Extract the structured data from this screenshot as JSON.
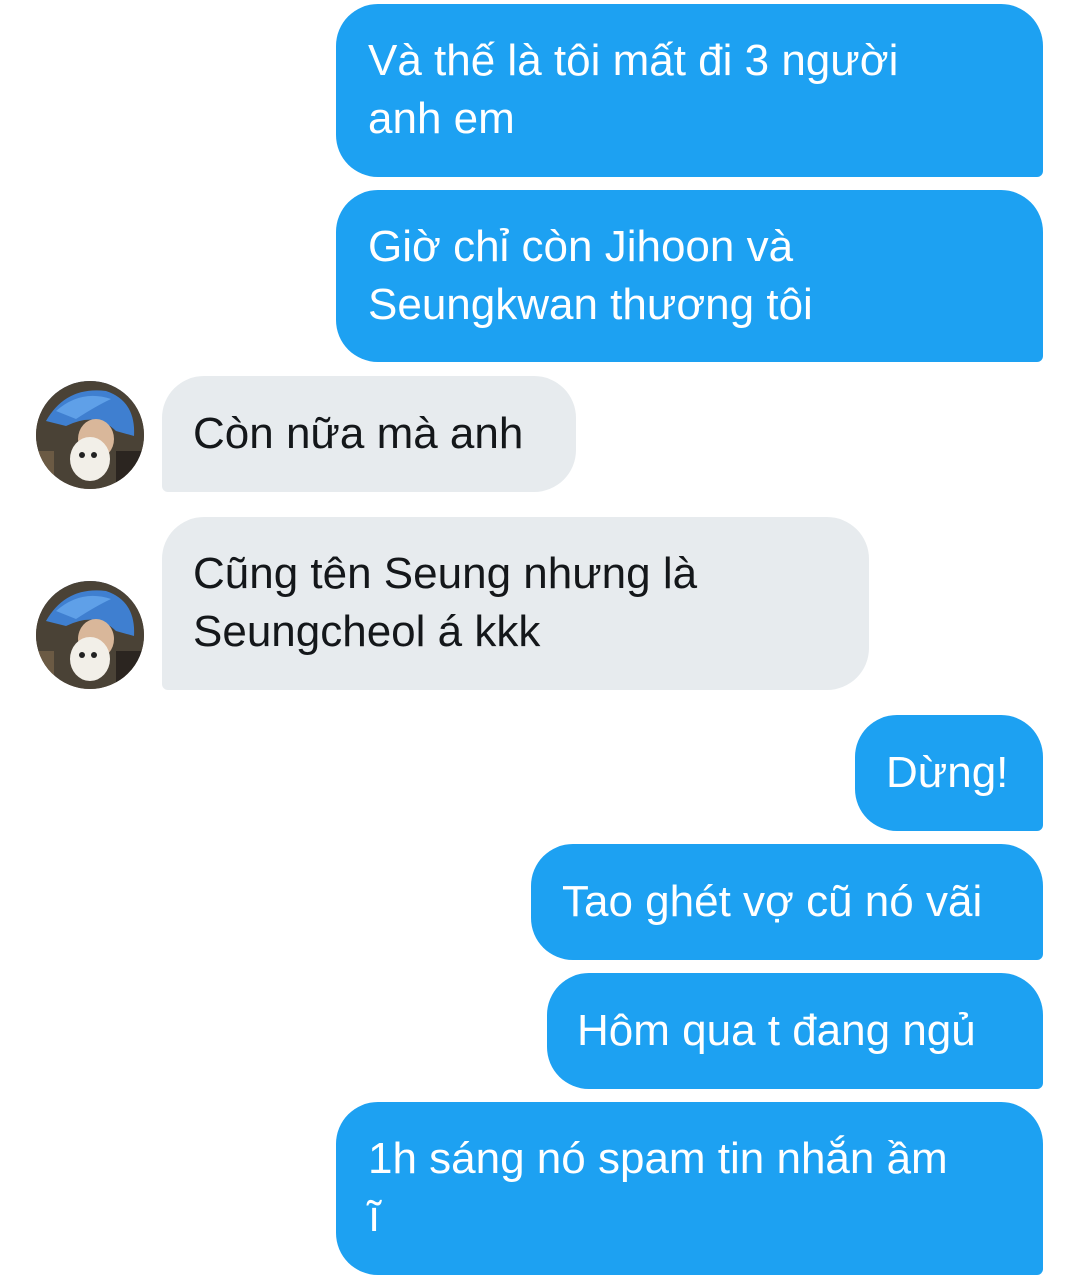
{
  "messages": [
    {
      "side": "out",
      "text": "Và thế là tôi mất đi 3 người\nanh em"
    },
    {
      "side": "out",
      "text": "Giờ chỉ còn Jihoon và\nSeungkwan thương tôi"
    },
    {
      "side": "in",
      "text": "Còn nữa mà anh"
    },
    {
      "side": "in",
      "text": "Cũng tên Seung nhưng là\nSeungcheol á kkk"
    },
    {
      "side": "out",
      "text": "Dừng!"
    },
    {
      "side": "out",
      "text": "Tao ghét vợ cũ nó vãi"
    },
    {
      "side": "out",
      "text": "Hôm qua t đang ngủ"
    },
    {
      "side": "out",
      "text": "1h sáng nó spam tin nhắn ầm\nĩ"
    }
  ],
  "colors": {
    "outgoing_bubble": "#1da1f2",
    "incoming_bubble": "#e7ebee",
    "outgoing_text": "#ffffff",
    "incoming_text": "#14171a"
  }
}
